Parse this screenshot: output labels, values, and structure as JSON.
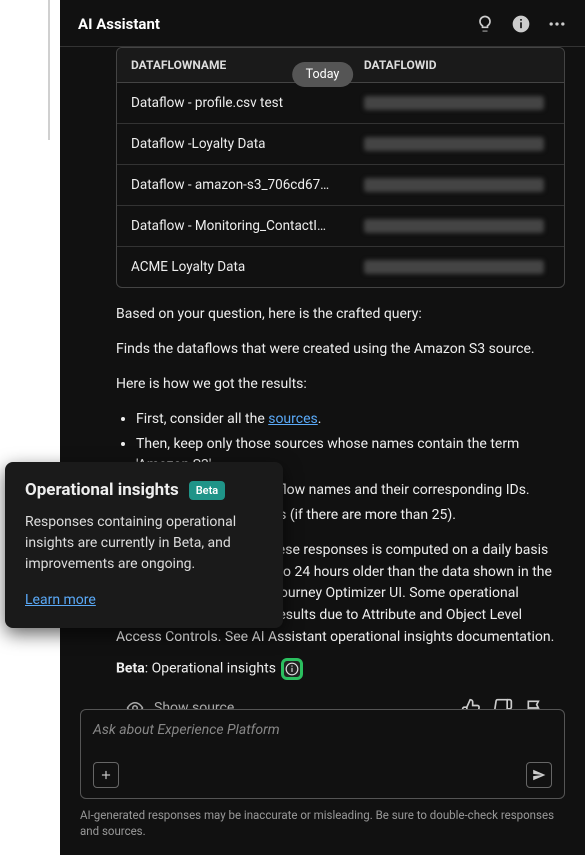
{
  "header": {
    "title": "AI Assistant"
  },
  "today_label": "Today",
  "table": {
    "headers": {
      "name": "DATAFLOWNAME",
      "id": "DATAFLOWID"
    },
    "rows": [
      {
        "name": "Dataflow - profile.csv test"
      },
      {
        "name": "Dataflow -Loyalty Data"
      },
      {
        "name": "Dataflow - amazon-s3_706cd67…"
      },
      {
        "name": "Dataflow - Monitoring_ContactI…"
      },
      {
        "name": "ACME Loyalty Data"
      }
    ]
  },
  "answer": {
    "intro": "Based on your question, here is the crafted query:",
    "query": "Finds the dataflows that were created using the Amazon S3 source.",
    "results_label": "Here is how we got the results:",
    "steps": {
      "s1a": "First, consider all the ",
      "s1_link": "sources",
      "s1b": ".",
      "s2": "Then, keep only those sources whose names contain the term 'Amazon S3'.",
      "s3": "Finally, extract the dataflow names and their corresponding IDs.",
      "s4": "Show the first 25 results (if there are more than 25)."
    },
    "note": "Note: The data used for these responses is computed on a daily basis and responses may be up to 24 hours older than the data shown in the Experience Platform and Journey Optimizer UI. Some operational insights may yield partial results due to Attribute and Object Level Access Controls. See AI Assistant operational insights documentation."
  },
  "beta_line": {
    "label": "Beta",
    "rest": ": Operational insights"
  },
  "show_source": "Show source",
  "tooltip": {
    "title": "Operational insights",
    "badge": "Beta",
    "body": "Responses containing operational insights are currently in Beta, and improvements are ongoing.",
    "link": "Learn more"
  },
  "input": {
    "placeholder": "Ask about Experience Platform"
  },
  "disclaimer": "AI-generated responses may be inaccurate or misleading. Be sure to double-check responses and sources."
}
